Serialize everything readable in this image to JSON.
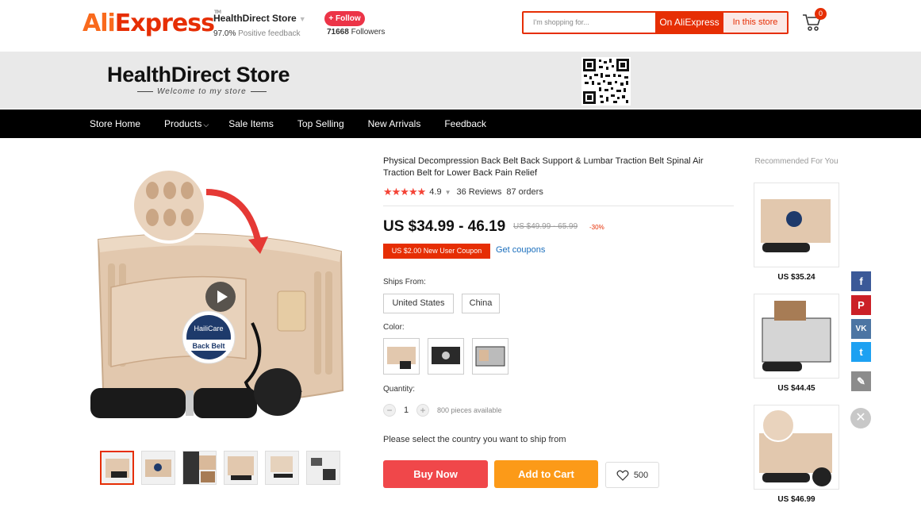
{
  "header": {
    "logo_part1": "Ali",
    "logo_part2": "Express",
    "logo_tm": "TM",
    "store_name": "HealthDirect Store",
    "feedback_pct": "97.0%",
    "feedback_label": "Positive feedback",
    "follow_label": "+ Follow",
    "followers_count": "71668",
    "followers_label": "Followers",
    "search_placeholder": "I'm shopping for...",
    "search_on_aliexpress": "On AliExpress",
    "search_in_store": "In this store",
    "cart_count": "0"
  },
  "banner": {
    "title": "HealthDirect Store",
    "subtitle": "Welcome to my store"
  },
  "nav": {
    "items": [
      "Store Home",
      "Products",
      "Sale Items",
      "Top Selling",
      "New Arrivals",
      "Feedback"
    ]
  },
  "gallery": {
    "brand_badge": "HailiCare",
    "badge_text": "Back Belt"
  },
  "product": {
    "title": "Physical Decompression Back Belt Back Support & Lumbar Traction Belt Spinal Air Traction Belt for Lower Back Pain Relief",
    "stars": "★★★★★",
    "rating": "4.9",
    "reviews": "36 Reviews",
    "orders": "87 orders",
    "price": "US $34.99 - 46.19",
    "old_price": "US $49.99 - 65.99",
    "discount": "-30%",
    "coupon": "US $2.00 New User Coupon",
    "get_coupons": "Get coupons",
    "ships_from_label": "Ships From:",
    "ships_from": [
      "United States",
      "China"
    ],
    "color_label": "Color:",
    "quantity_label": "Quantity:",
    "quantity": "1",
    "available": "800 pieces available",
    "ship_note": "Please select the country you want to ship from",
    "buy_now": "Buy Now",
    "add_to_cart": "Add to Cart",
    "wishlist_count": "500"
  },
  "recommended": {
    "title": "Recommended For You",
    "items": [
      {
        "price": "US $35.24"
      },
      {
        "price": "US $44.45"
      },
      {
        "price": "US $46.99"
      }
    ]
  },
  "share": {
    "facebook": "f",
    "pinterest": "P",
    "vk": "VK",
    "twitter": "t"
  },
  "colors": {
    "brand_red": "#e62e04",
    "buy_red": "#f0474a",
    "cart_orange": "#fc9a18",
    "facebook": "#3b5998",
    "pinterest": "#cb2027",
    "vk": "#4c75a3",
    "twitter": "#1da1f2"
  }
}
